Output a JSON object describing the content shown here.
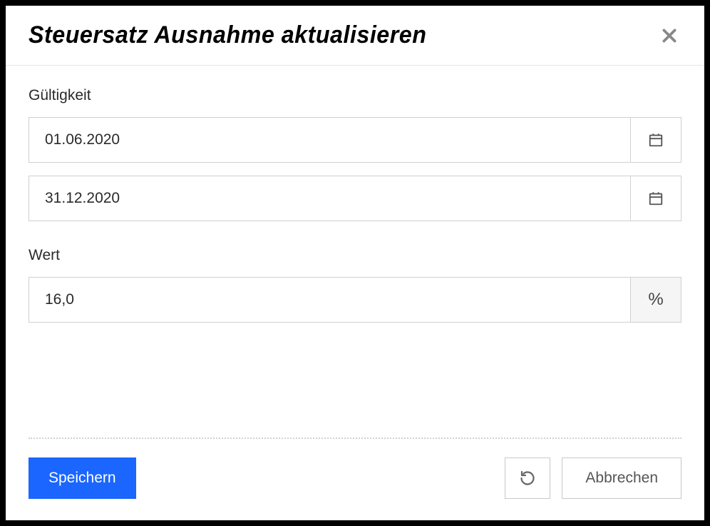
{
  "modal": {
    "title": "Steuersatz Ausnahme aktualisieren"
  },
  "form": {
    "validity_label": "Gültigkeit",
    "date_from": "01.06.2020",
    "date_to": "31.12.2020",
    "value_label": "Wert",
    "value": "16,0",
    "value_unit": "%"
  },
  "actions": {
    "save": "Speichern",
    "cancel": "Abbrechen"
  }
}
